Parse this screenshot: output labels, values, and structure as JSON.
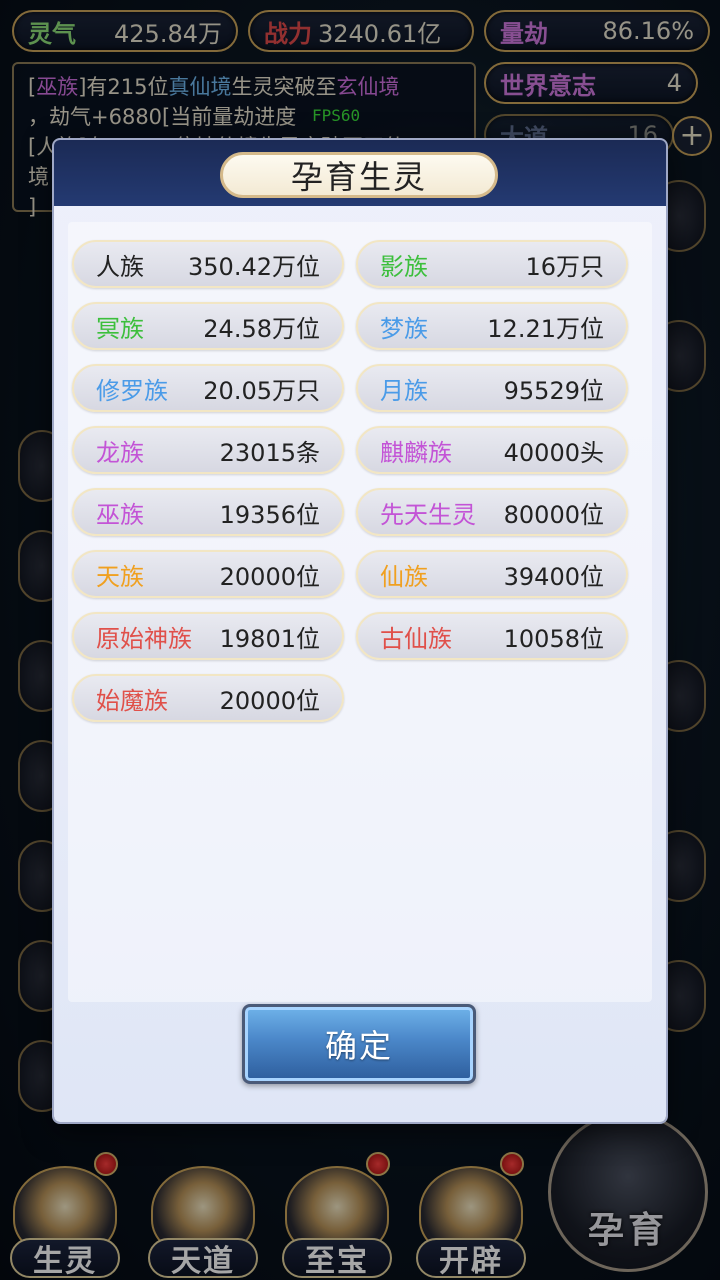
{
  "hud": {
    "lingqi_label": "灵气",
    "lingqi_value": "425.84万",
    "zhanli_label": "战力",
    "zhanli_value": "3240.61亿",
    "liangjie_label": "量劫",
    "liangjie_value": "86.16%",
    "shijie_label": "世界意志",
    "shijie_value": "4",
    "dadao_label": "大道",
    "dadao_value": "16",
    "plus_symbol": "+"
  },
  "log": {
    "line1_a": "[",
    "line1_race": "巫族",
    "line1_b": "]有215位",
    "line1_realm": "真仙境",
    "line1_c": "生灵突破至",
    "line1_realm2": "玄仙境",
    "line2": "，劫气+6880[当前量劫进度",
    "line3": "[人族]有35497位地仙境生灵突破至天仙",
    "line4": "境",
    "line5": "]",
    "fps": "FPS60"
  },
  "modal": {
    "title": "孕育生灵",
    "confirm_label": "确定",
    "races": [
      {
        "name": "人族",
        "count": "350.42万位",
        "color": "#222222"
      },
      {
        "name": "影族",
        "count": "16万只",
        "color": "#3cbf3c"
      },
      {
        "name": "冥族",
        "count": "24.58万位",
        "color": "#3cbf3c"
      },
      {
        "name": "梦族",
        "count": "12.21万位",
        "color": "#4a9be8"
      },
      {
        "name": "修罗族",
        "count": "20.05万只",
        "color": "#4a9be8"
      },
      {
        "name": "月族",
        "count": "95529位",
        "color": "#4a9be8"
      },
      {
        "name": "龙族",
        "count": "23015条",
        "color": "#c354d6"
      },
      {
        "name": "麒麟族",
        "count": "40000头",
        "color": "#c354d6"
      },
      {
        "name": "巫族",
        "count": "19356位",
        "color": "#c354d6"
      },
      {
        "name": "先天生灵",
        "count": "80000位",
        "color": "#c354d6"
      },
      {
        "name": "天族",
        "count": "20000位",
        "color": "#f0a020"
      },
      {
        "name": "仙族",
        "count": "39400位",
        "color": "#f0a020"
      },
      {
        "name": "原始神族",
        "count": "19801位",
        "color": "#e0504a"
      },
      {
        "name": "古仙族",
        "count": "10058位",
        "color": "#e0504a"
      },
      {
        "name": "始魔族",
        "count": "20000位",
        "color": "#e0504a"
      }
    ]
  },
  "bottom_nav": {
    "items": [
      {
        "label": "生灵",
        "badge": true
      },
      {
        "label": "天道",
        "badge": false
      },
      {
        "label": "至宝",
        "badge": true
      },
      {
        "label": "开辟",
        "badge": true
      }
    ],
    "yuyu_label": "孕育"
  },
  "colors": {
    "accent_gold": "#c9a45a",
    "confirm_blue": "#4a86c8"
  }
}
